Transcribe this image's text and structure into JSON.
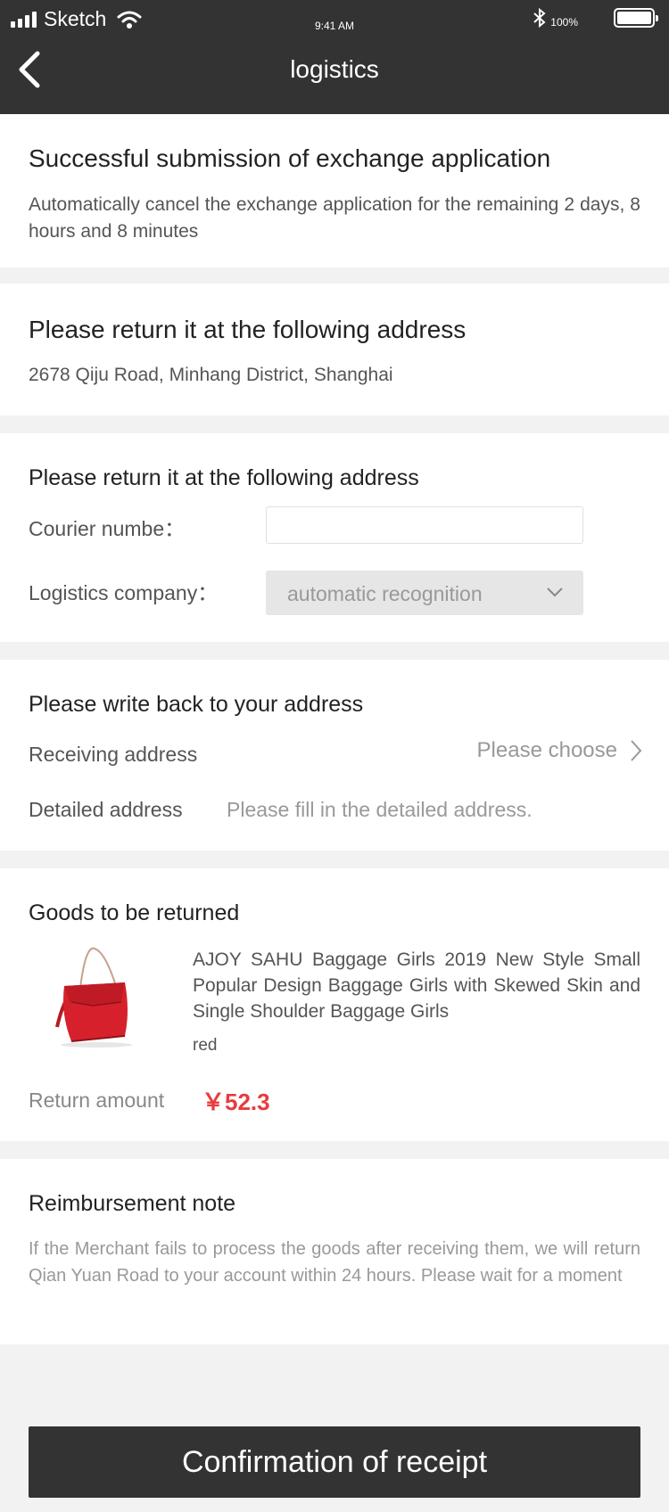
{
  "status_bar": {
    "carrier": "Sketch",
    "time": "9:41 AM",
    "battery": "100%"
  },
  "header": {
    "title": "logistics"
  },
  "submission": {
    "title": "Successful submission of exchange application",
    "message": "Automatically cancel the exchange application for the remaining 2 days, 8 hours and 8 minutes"
  },
  "return_address": {
    "title": "Please return it at the following address",
    "address": "2678 Qiju Road, Minhang District, Shanghai"
  },
  "logistics_form": {
    "title": "Please return it at the following address",
    "courier_label": "Courier numbe：",
    "courier_value": "",
    "company_label": "Logistics company：",
    "company_value": "automatic recognition"
  },
  "write_back": {
    "title": "Please write back to your address",
    "receiving_label": "Receiving address",
    "receiving_value": "Please choose",
    "detailed_label": "Detailed address",
    "detailed_placeholder": "Please fill in the detailed address."
  },
  "goods": {
    "title": "Goods to be returned",
    "product_name": "AJOY SAHU Baggage Girls 2019 New Style Small Popular Design Baggage Girls with Skewed Skin and Single Shoulder Baggage Girls",
    "color": "red",
    "amount_label": "Return amount",
    "amount": "￥52.3"
  },
  "note": {
    "title": "Reimbursement note",
    "text": "If the Merchant fails to process the goods after receiving them, we will return Qian Yuan Road to your account within 24 hours. Please wait for a moment"
  },
  "confirm_button": "Confirmation of receipt",
  "colors": {
    "header": "#333333",
    "price": "#e93b3d",
    "page_bg": "#f2f2f2"
  }
}
